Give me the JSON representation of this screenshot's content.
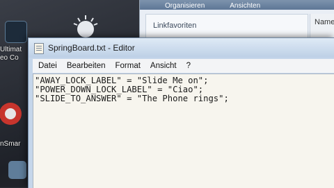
{
  "desktop": {
    "icons": [
      {
        "label": "Ultimat"
      },
      {
        "label": "eo Co"
      },
      {
        "label": "nSmar"
      }
    ]
  },
  "explorer": {
    "toolbar_left": "Organisieren",
    "toolbar_right": "Ansichten",
    "link_favorites_label": "Linkfavoriten",
    "column_header": "Name"
  },
  "notepad": {
    "title": "SpringBoard.txt - Editor",
    "menu": {
      "file": "Datei",
      "edit": "Bearbeiten",
      "format": "Format",
      "view": "Ansicht",
      "help": "?"
    },
    "lines": [
      "\"AWAY_LOCK_LABEL\" = \"Slide Me on\";",
      "\"POWER_DOWN_LOCK_LABEL\" = \"Ciao\";",
      "\"SLIDE_TO_ANSWER\" = \"The Phone rings\";"
    ]
  }
}
